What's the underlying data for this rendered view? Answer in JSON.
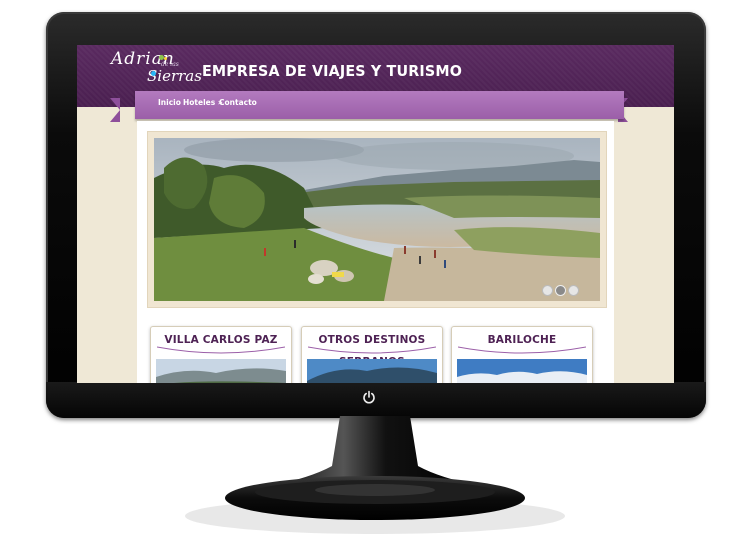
{
  "site": {
    "logo_script_1": "Adrian",
    "logo_script_2": "Sierras",
    "logo_small": "de las",
    "title": "EMPRESA DE VIAJES Y TURISMO"
  },
  "nav": {
    "items": [
      {
        "label": "Inicio"
      },
      {
        "label": "Hoteles »"
      },
      {
        "label": "Contacto"
      }
    ]
  },
  "slider": {
    "dots": 3,
    "active_dot": 2
  },
  "cards": [
    {
      "title": "VILLA CARLOS PAZ"
    },
    {
      "title": "OTROS DESTINOS SERRANOS"
    },
    {
      "title": "BARILOCHE"
    }
  ],
  "icons": {
    "power": "power-icon"
  },
  "colors": {
    "header": "#4a1f50",
    "ribbon": "#9b5fa8",
    "background": "#efe8d6",
    "card_title": "#4e2254"
  }
}
